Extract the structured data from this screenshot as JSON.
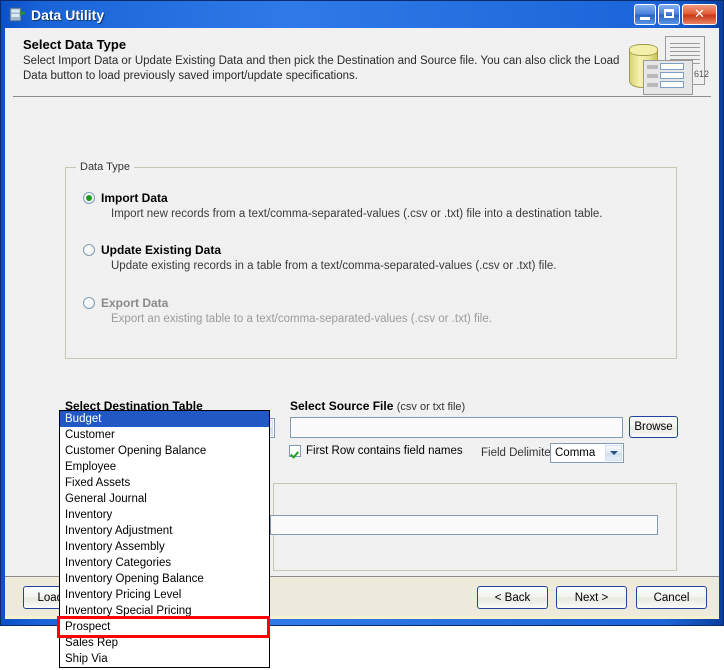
{
  "window": {
    "title": "Data Utility",
    "icon": "data-utility-icon",
    "controls": {
      "minimize": "minimize-button",
      "maximize": "maximize-button",
      "close": "close-button"
    },
    "accent_titlebar": "#2f7ae8",
    "border_color": "#0a2a6b"
  },
  "header": {
    "title": "Select Data Type",
    "description": "Select Import Data or Update Existing Data and then pick the Destination and Source file.  You can also click the Load Data button to load previously saved import/update specifications.",
    "graphic_number": "612"
  },
  "data_type_group": {
    "legend": "Data Type",
    "options": [
      {
        "label": "Import Data",
        "description": "Import new records from a text/comma-separated-values (.csv or .txt) file into a destination table.",
        "selected": true,
        "enabled": true
      },
      {
        "label": "Update Existing Data",
        "description": "Update existing records in a table from a text/comma-separated-values (.csv or .txt) file.",
        "selected": false,
        "enabled": true
      },
      {
        "label": "Export Data",
        "description": "Export an existing table to a text/comma-separated-values (.csv or .txt) file.",
        "selected": false,
        "enabled": false
      }
    ]
  },
  "destination": {
    "label": "Select Destination Table",
    "combo_value": "",
    "combo_expanded": true,
    "options": [
      "Budget",
      "Customer",
      "Customer Opening Balance",
      "Employee",
      "Fixed Assets",
      "General Journal",
      "Inventory",
      "Inventory Adjustment",
      "Inventory Assembly",
      "Inventory Categories",
      "Inventory Opening Balance",
      "Inventory Pricing Level",
      "Inventory Special Pricing",
      "Prospect",
      "Sales Rep",
      "Ship Via"
    ],
    "selected_index": 0,
    "highlighted_option": "Prospect",
    "highlight_color": "#ff0000"
  },
  "source": {
    "label": "Select Source File",
    "label_note": "(csv or txt file)",
    "path_value": "",
    "path_placeholder": "",
    "browse_label": "Browse",
    "first_row_label": "First Row contains field names",
    "first_row_checked": true,
    "delimiter_label": "Field Delimiter",
    "delimiter_value": "Comma"
  },
  "mapping_group": {
    "legend": "",
    "field_value": ""
  },
  "footer": {
    "load_data_label": "Load Data",
    "back_label": "< Back",
    "next_label": "Next >",
    "cancel_label": "Cancel"
  }
}
